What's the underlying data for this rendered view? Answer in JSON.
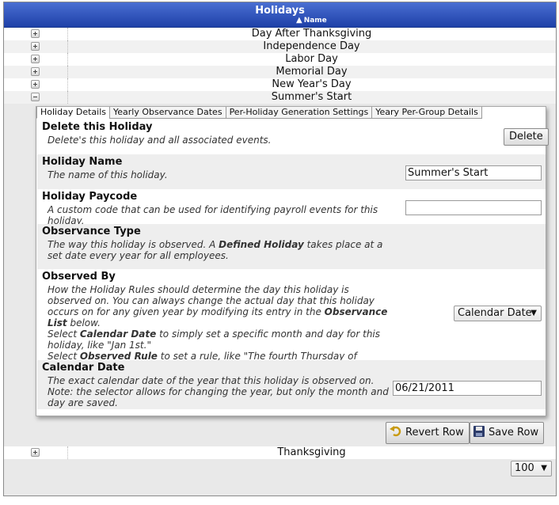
{
  "grid": {
    "title": "Holidays",
    "sort_column": "Name",
    "rows_before": [
      "Day After Thanksgiving",
      "Independence Day",
      "Labor Day",
      "Memorial Day",
      "New Year's Day"
    ],
    "expanded_row": "Summer's Start",
    "rows_after": [
      "Thanksgiving"
    ],
    "page_size": "100"
  },
  "detail": {
    "tabs": [
      "Holiday Details",
      "Yearly Observance Dates",
      "Per-Holiday Generation Settings",
      "Yeary Per-Group Details"
    ],
    "delete": {
      "heading": "Delete this Holiday",
      "desc": "Delete's this holiday and all associated events.",
      "button": "Delete"
    },
    "name": {
      "heading": "Holiday Name",
      "desc": "The name of this holiday.",
      "value": "Summer's Start"
    },
    "paycode": {
      "heading": "Holiday Paycode",
      "desc": "A custom code that can be used for identifying payroll events for this holiday.",
      "value": ""
    },
    "observance_type": {
      "heading": "Observance Type",
      "desc_1": "The way this holiday is observed. A ",
      "desc_bold": "Defined Holiday",
      "desc_2": " takes place at a set date every year for all employees."
    },
    "observed_by": {
      "heading": "Observed By",
      "desc_1": "How the Holiday Rules should determine the day this holiday is observed on. You can always change the actual day that this holiday occurs on for any given year by modifying its entry in the ",
      "desc_bold_1": "Observance List",
      "desc_2": " below.",
      "desc_3": "Select ",
      "desc_bold_2": "Calendar Date",
      "desc_4": " to simply set a specific month and day for this holiday, like \"Jan 1st.\"",
      "desc_5": "Select ",
      "desc_bold_3": "Observed Rule",
      "desc_6": " to set a rule, like \"The fourth Thursday of November.\"",
      "selected": "Calendar Date"
    },
    "calendar_date": {
      "heading": "Calendar Date",
      "desc_1": "The exact calendar date of the year that this holiday is observed on.",
      "desc_2": "Note: the selector allows for changing the year, but only the month and day are saved.",
      "value": "06/21/2011"
    },
    "revert_label": "Revert Row",
    "save_label": "Save Row"
  }
}
